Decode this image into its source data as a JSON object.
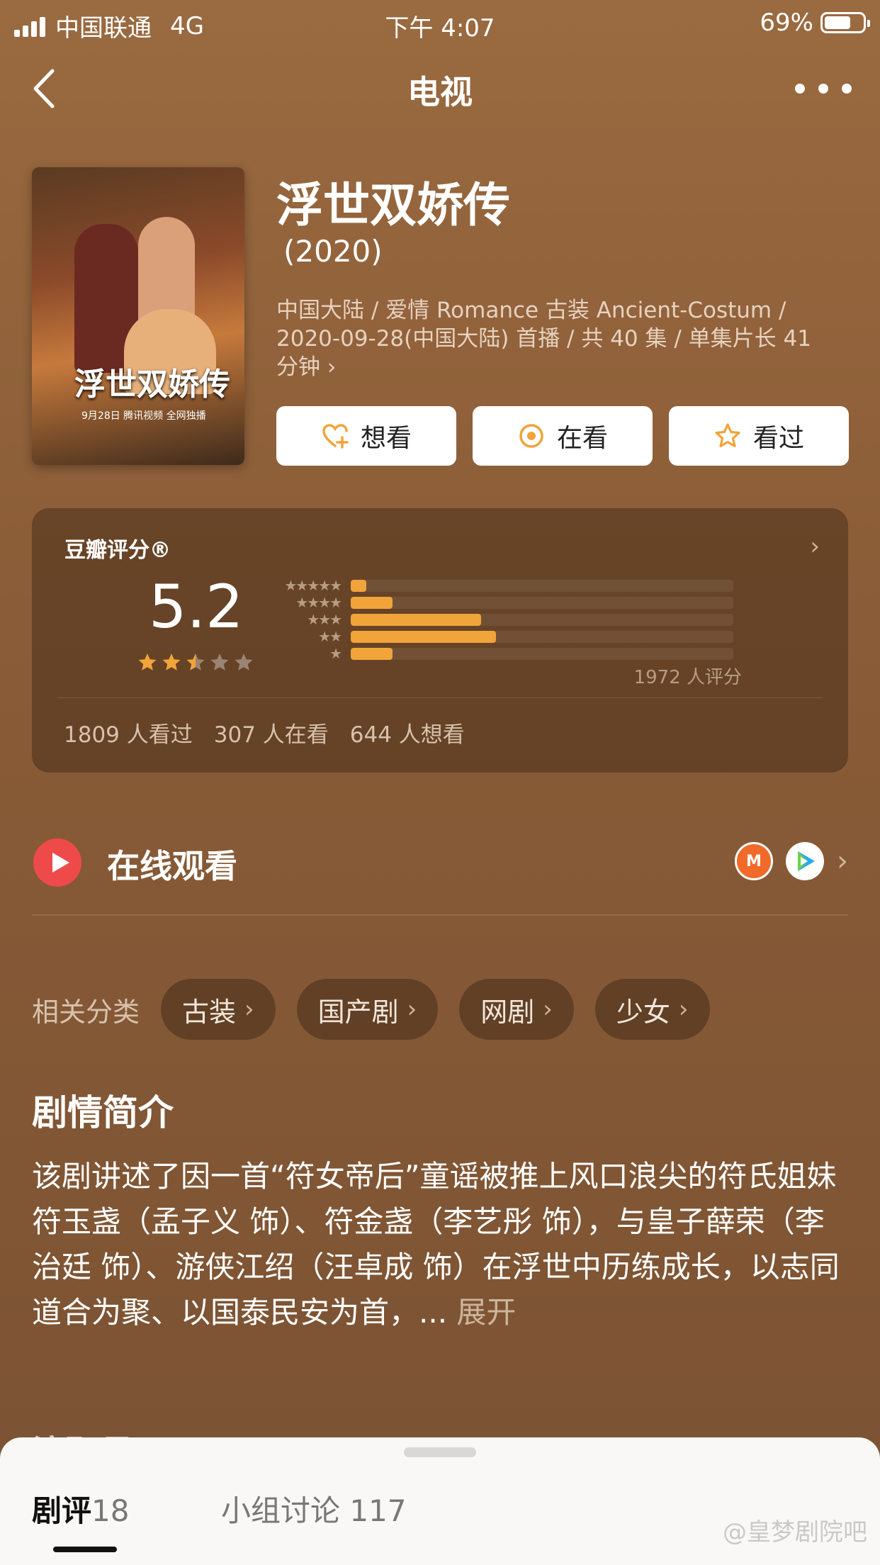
{
  "status_bar": {
    "carrier": "中国联通",
    "network": "4G",
    "time": "下午 4:07",
    "battery_percent": "69%",
    "battery_level": 0.69
  },
  "nav": {
    "title": "电视",
    "back_icon": "chevron-left-icon",
    "more_icon": "more-dots-icon"
  },
  "show": {
    "title": "浮世双娇传",
    "year": "(2020)",
    "meta": "中国大陆 / 爱情 Romance 古装 Ancient-Costum / 2020-09-28(中国大陆) 首播 / 共 40 集 / 单集片长 41 分钟",
    "meta_arrow": "›",
    "poster_title": "浮世双娇传",
    "poster_caption": "9月28日 腾讯视频 全网独播"
  },
  "actions": {
    "want": "想看",
    "watching": "在看",
    "watched": "看过"
  },
  "rating": {
    "label": "豆瓣评分®",
    "score": "5.2",
    "stars": 2.5,
    "count": "1972 人评分",
    "distribution": [
      {
        "stars": "★★★★★",
        "fraction": 0.04
      },
      {
        "stars": "★★★★",
        "fraction": 0.11
      },
      {
        "stars": "★★★",
        "fraction": 0.34
      },
      {
        "stars": "★★",
        "fraction": 0.38
      },
      {
        "stars": "★",
        "fraction": 0.11
      }
    ],
    "watched": "1809 人看过",
    "watching": "307 人在看",
    "want": "644 人想看"
  },
  "online": {
    "label": "在线观看",
    "platforms": [
      "mango-tv-icon",
      "tencent-video-icon"
    ]
  },
  "related": {
    "label": "相关分类",
    "chips": [
      "古装",
      "国产剧",
      "网剧",
      "少女"
    ]
  },
  "synopsis": {
    "title": "剧情简介",
    "text": "该剧讲述了因一首“符女帝后”童谣被推上风口浪尖的符氏姐妹符玉盏（孟子义 饰）、符金盏（李艺彤 饰），与皇子薛荣（李治廷 饰）、游侠江绍（汪卓成 饰）在浮世中历练成长，以志同道合为聚、以国泰民安为首，... ",
    "expand": "展开"
  },
  "cast_peek": "演职员",
  "bottom_sheet": {
    "tab_reviews": "剧评",
    "reviews_count": "18",
    "tab_groups": "小组讨论 117",
    "watermark": "@皇梦剧院吧"
  },
  "colors": {
    "background": "#8a5c37",
    "accent": "#f0a43a",
    "play_red": "#ef4a4a"
  }
}
